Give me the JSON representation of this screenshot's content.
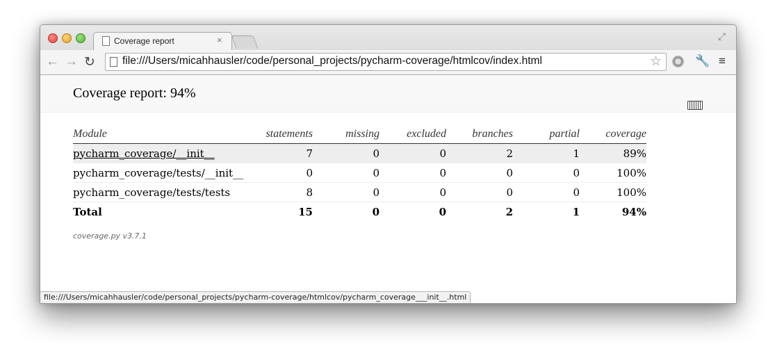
{
  "browser": {
    "tab_title": "Coverage report",
    "tab_close": "×",
    "url": "file:///Users/micahhausler/code/personal_projects/pycharm-coverage/htmlcov/index.html",
    "status_url": "file:///Users/micahhausler/code/personal_projects/pycharm-coverage/htmlcov/pycharm_coverage___init__.html",
    "icons": {
      "back": "←",
      "forward": "→",
      "reload": "↻",
      "star": "☆",
      "wrench": "🔧",
      "menu": "≡",
      "fullscreen": "⤢"
    }
  },
  "report": {
    "title": "Coverage report: 94%",
    "headers": {
      "module": "Module",
      "statements": "statements",
      "missing": "missing",
      "excluded": "excluded",
      "branches": "branches",
      "partial": "partial",
      "coverage": "coverage"
    },
    "rows": [
      {
        "module": "pycharm_coverage/__init__",
        "statements": "7",
        "missing": "0",
        "excluded": "0",
        "branches": "2",
        "partial": "1",
        "coverage": "89%"
      },
      {
        "module": "pycharm_coverage/tests/__init__",
        "statements": "0",
        "missing": "0",
        "excluded": "0",
        "branches": "0",
        "partial": "0",
        "coverage": "100%"
      },
      {
        "module": "pycharm_coverage/tests/tests",
        "statements": "8",
        "missing": "0",
        "excluded": "0",
        "branches": "0",
        "partial": "0",
        "coverage": "100%"
      }
    ],
    "total": {
      "module": "Total",
      "statements": "15",
      "missing": "0",
      "excluded": "0",
      "branches": "2",
      "partial": "1",
      "coverage": "94%"
    },
    "footer": "coverage.py v3.7.1"
  }
}
